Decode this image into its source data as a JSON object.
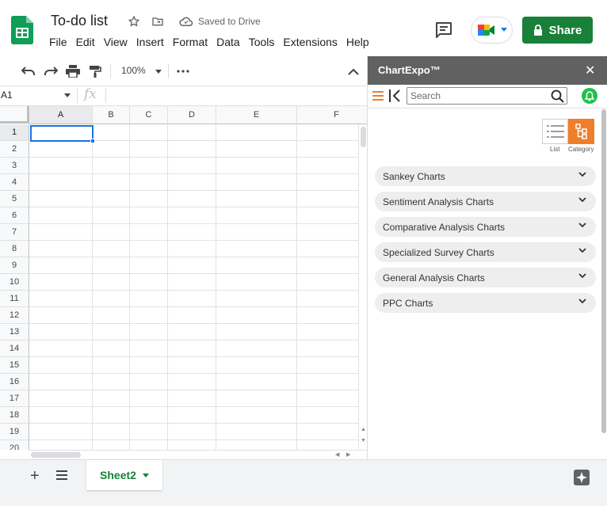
{
  "doc": {
    "title": "To-do list",
    "saved_status": "Saved to Drive"
  },
  "menu": [
    "File",
    "Edit",
    "View",
    "Insert",
    "Format",
    "Data",
    "Tools",
    "Extensions",
    "Help"
  ],
  "share": {
    "label": "Share"
  },
  "toolbar": {
    "zoom": "100%"
  },
  "formula_bar": {
    "name_box": "A1",
    "fx": "fx"
  },
  "grid": {
    "columns": [
      "A",
      "B",
      "C",
      "D",
      "E",
      "F"
    ],
    "rows": [
      "1",
      "2",
      "3",
      "4",
      "5",
      "6",
      "7",
      "8",
      "9",
      "10",
      "11",
      "12",
      "13",
      "14",
      "15",
      "16",
      "17",
      "18",
      "19",
      "20"
    ],
    "active_cell": "A1"
  },
  "sheets": {
    "active": "Sheet2"
  },
  "panel": {
    "title": "ChartExpo™",
    "search_placeholder": "Search",
    "view_labels": {
      "list": "List",
      "category": "Category"
    },
    "categories": [
      "Sankey Charts",
      "Sentiment Analysis Charts",
      "Comparative Analysis Charts",
      "Specialized Survey Charts",
      "General Analysis Charts",
      "PPC Charts"
    ]
  },
  "colors": {
    "share_green": "#188038",
    "panel_header": "#616161",
    "accent_orange": "#f07d2a",
    "selection_blue": "#1a73e8",
    "bell_green": "#20c04a"
  }
}
